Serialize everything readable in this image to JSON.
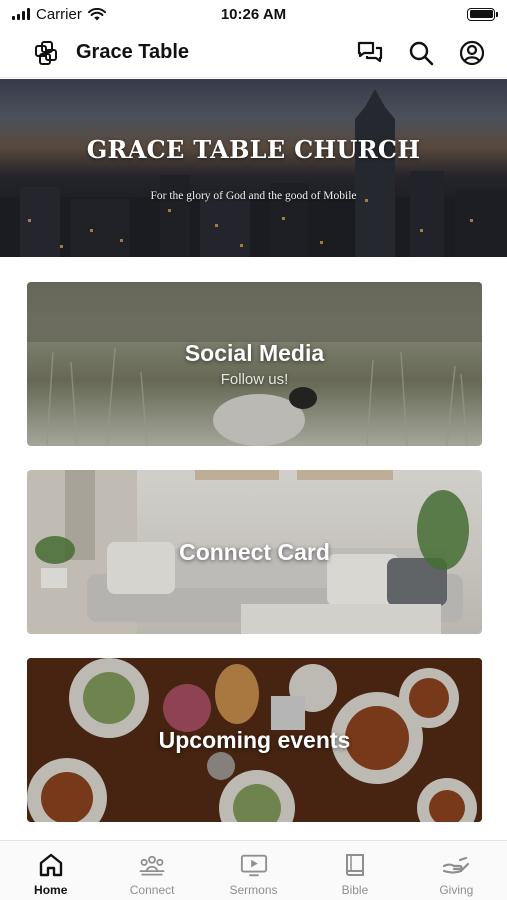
{
  "status_bar": {
    "carrier": "Carrier",
    "time": "10:26 AM"
  },
  "header": {
    "app_title": "Grace Table",
    "icons": [
      "logo-icon",
      "chat-icon",
      "search-icon",
      "account-icon"
    ]
  },
  "hero": {
    "title": "GRACE TABLE CHURCH",
    "subtitle": "For the glory of God and the good of Mobile"
  },
  "cards": [
    {
      "title": "Social Media",
      "subtitle": "Follow us!"
    },
    {
      "title": "Connect Card",
      "subtitle": ""
    },
    {
      "title": "Upcoming events",
      "subtitle": ""
    }
  ],
  "tab_bar": {
    "active": "Home",
    "tabs": [
      {
        "label": "Home",
        "icon": "home-icon"
      },
      {
        "label": "Connect",
        "icon": "people-icon"
      },
      {
        "label": "Sermons",
        "icon": "play-screen-icon"
      },
      {
        "label": "Bible",
        "icon": "book-icon"
      },
      {
        "label": "Giving",
        "icon": "giving-hand-icon"
      }
    ]
  },
  "colors": {
    "active_tab": "#111111",
    "inactive_tab": "#8f8f8f",
    "header_border": "#e6e6e6"
  }
}
